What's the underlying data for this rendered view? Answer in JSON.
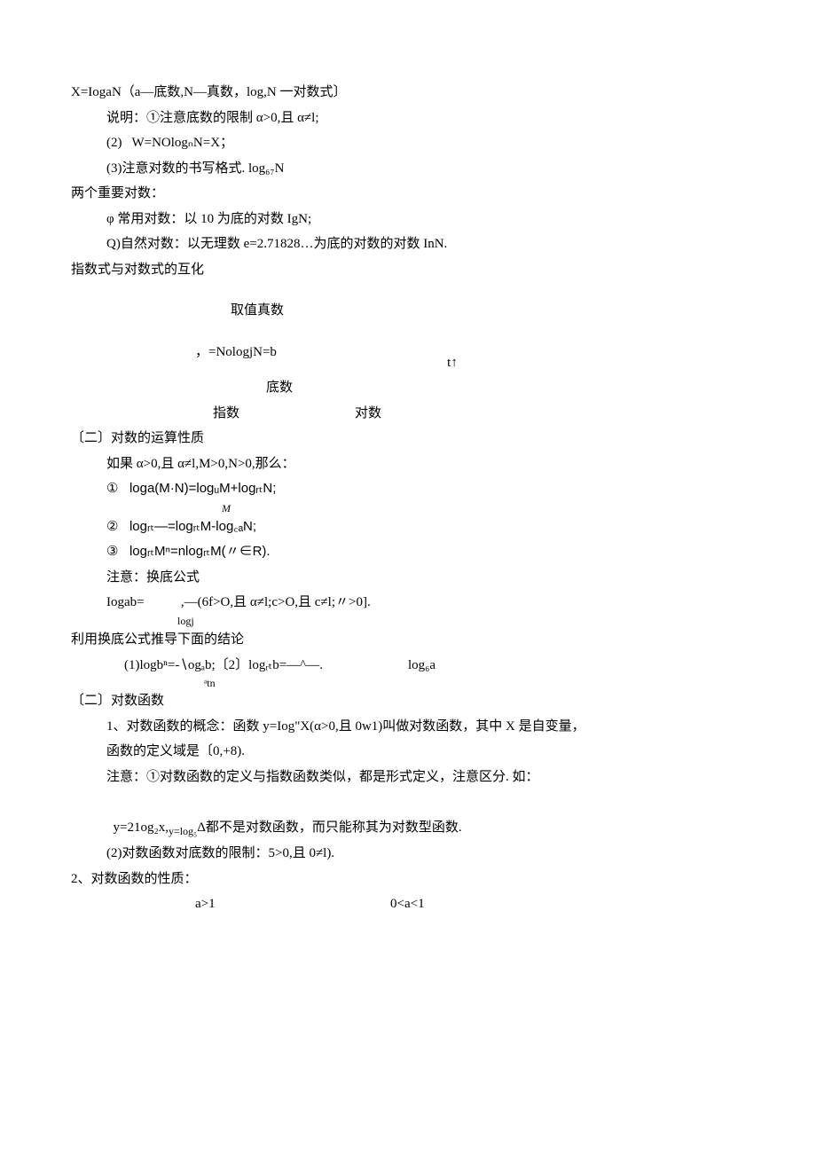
{
  "lines": {
    "l1": "X=IogaN（a—底数,N—真数，log,N 一对数式〕",
    "l2": "说明：①注意底数的限制 α>0,且 α≠l;",
    "l3": "(2)   W=NOlogₙN=X；",
    "l4": "(3)注意对数的书写格式. log₆₇N",
    "l5": "两个重要对数：",
    "l6": "φ 常用对数：以 10 为底的对数 IgN;",
    "l7": "Q)自然对数：以无理数 e=2.71828…为底的对数的对数 InN.",
    "l8": "指数式与对数式的互化",
    "l9": "取值真数",
    "l10": "，=NologjN=b",
    "l11": "t↑",
    "l12": "底数",
    "l13a": "指数",
    "l13b": "对数",
    "l14": "〔二〕对数的运算性质",
    "l15": "如果 α>0,且 α≠l,M>0,N>0,那么：",
    "l16": "①   loga(M·N)=logᵤM+logᵣₜN;",
    "l16b": "M",
    "l17": "②   logᵣₜ—=logᵣₜM-log꜀ₐN;",
    "l18": "③   logᵣₜMⁿ=nlogᵣₜM(〃∈R).",
    "l19": "注意：换底公式",
    "l20": "Iogab=           ,—(6f>O,且 α≠l;c>O,且 c≠l;〃>0].",
    "l20b": "logj",
    "l21": "利用换底公式推导下面的结论",
    "l22": "(1)logbⁿ=-∖ogₐb;〔2〕logᵣₜb=—^—.",
    "l22b": "ᵃtn",
    "l22c": "log₆a",
    "l23": "〔二〕对数函数",
    "l24": "1、对数函数的概念：函数 y=Iog\"X(α>0,且 0w1)叫做对数函数，其中 X 是自变量，",
    "l25": "函数的定义域是〔0,+8).",
    "l26": "注意：①对数函数的定义与指数函数类似，都是形式定义，注意区分. 如：",
    "l27": "y=21og₂x,",
    "l27b": "y=log₅",
    "l27c": "Δ都不是对数函数，而只能称其为对数型函数.",
    "l28": "(2)对数函数对底数的限制：5>0,且 0≠l).",
    "l29": "2、对数函数的性质：",
    "l30a": "a>1",
    "l30b": "0<a<1"
  }
}
